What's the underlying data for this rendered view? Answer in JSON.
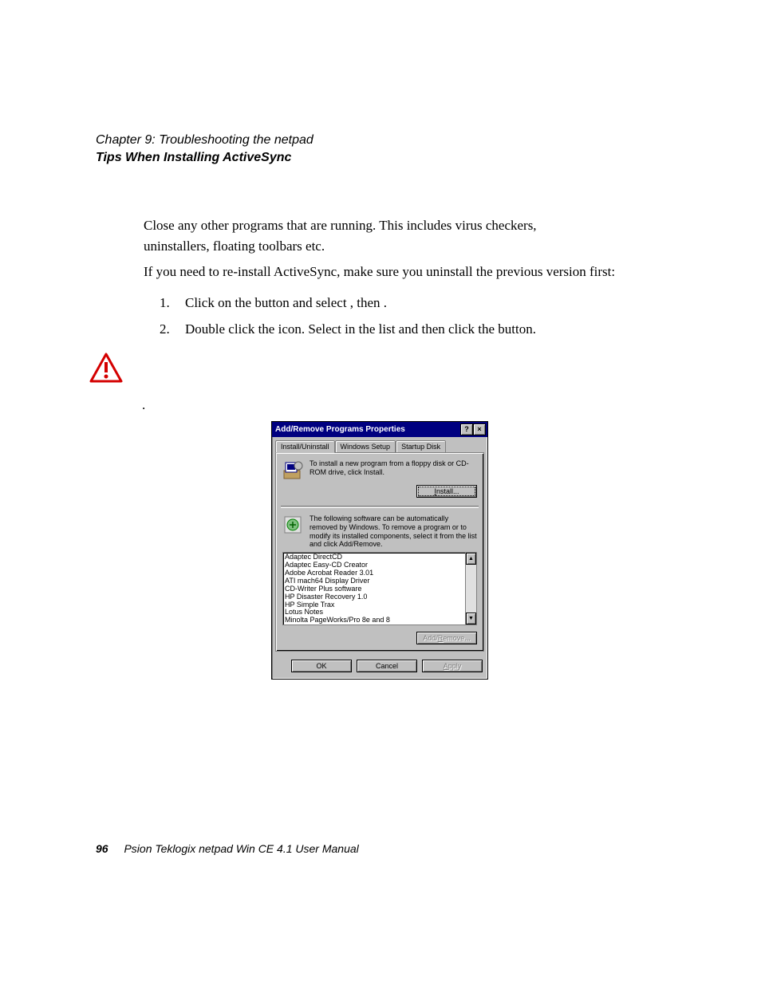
{
  "header": {
    "chapter": "Chapter 9:  Troubleshooting the netpad",
    "section": "Tips When Installing ActiveSync"
  },
  "body": {
    "para1": "Close any other programs that are running. This includes virus checkers, uninstallers, floating toolbars etc.",
    "para2": "If you need to re-install ActiveSync, make sure you uninstall the previous version first:",
    "list": [
      {
        "num": "1.",
        "text": "Click on the           button and select               , then                        ."
      },
      {
        "num": "2.",
        "text": "Double click the                                            icon. Select                          in the list and then click the                         button."
      }
    ],
    "dot": "."
  },
  "dialog": {
    "title": "Add/Remove Programs Properties",
    "help_btn": "?",
    "close_btn": "×",
    "tabs": [
      "Install/Uninstall",
      "Windows Setup",
      "Startup Disk"
    ],
    "install_text": "To install a new program from a floppy disk or CD-ROM drive, click Install.",
    "install_btn": "Install...",
    "remove_text": "The following software can be automatically removed by Windows. To remove a program or to modify its installed components, select it from the list and click Add/Remove.",
    "programs": [
      "Adaptec DirectCD",
      "Adaptec Easy-CD Creator",
      "Adobe Acrobat Reader 3.01",
      "ATI mach64 Display Driver",
      "CD-Writer Plus software",
      "HP Disaster Recovery 1.0",
      "HP Simple Trax",
      "Lotus Notes",
      "Minolta PageWorks/Pro 8e and 8"
    ],
    "add_remove_btn": "Add/Remove...",
    "ok_btn": "OK",
    "cancel_btn": "Cancel",
    "apply_btn": "Apply"
  },
  "footer": {
    "page_num": "96",
    "book": "Psion Teklogix netpad Win CE 4.1 User Manual"
  }
}
